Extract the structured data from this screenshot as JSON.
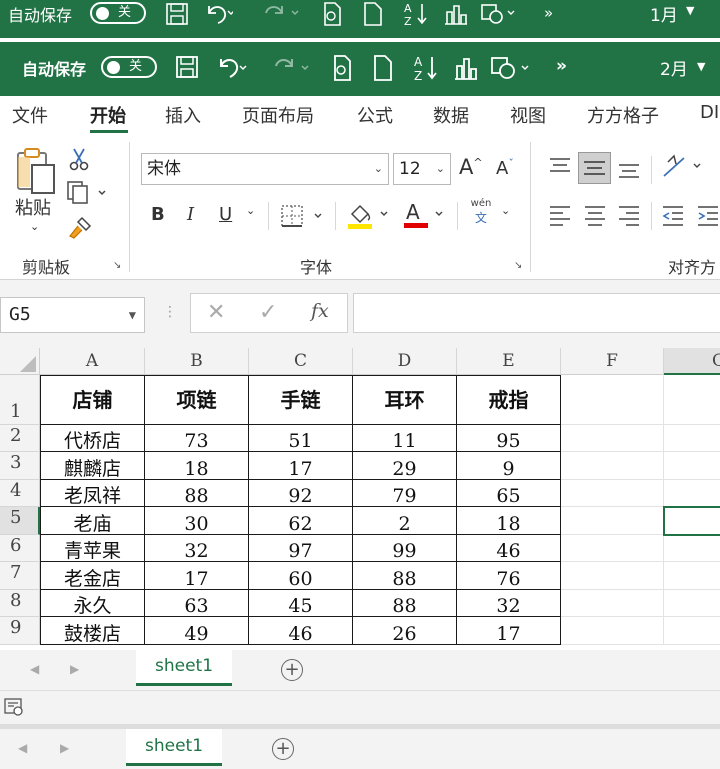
{
  "back_window": {
    "autosave_label": "自动保存",
    "toggle_state": "关",
    "month": "1月"
  },
  "window": {
    "autosave_label": "自动保存",
    "toggle_state": "关",
    "month": "2月"
  },
  "menu": {
    "items": [
      "文件",
      "开始",
      "插入",
      "页面布局",
      "公式",
      "数据",
      "视图",
      "方方格子",
      "DI"
    ],
    "active": "开始"
  },
  "ribbon": {
    "clipboard": {
      "paste_label": "粘贴",
      "group_label": "剪贴板"
    },
    "font": {
      "font_name": "宋体",
      "font_size": "12",
      "bold": "B",
      "italic": "I",
      "underline": "U",
      "grow": "A",
      "shrink": "A",
      "font_color_letter": "A",
      "phonetic_top": "wén",
      "phonetic_bottom": "文",
      "group_label": "字体"
    },
    "alignment": {
      "group_label": "对齐方"
    }
  },
  "formula_bar": {
    "name_box": "G5",
    "fx": "fx",
    "formula": ""
  },
  "sheet": {
    "columns": [
      "A",
      "B",
      "C",
      "D",
      "E",
      "F",
      "G"
    ],
    "selected_column": "G",
    "selected_row": 5,
    "row_numbers": [
      "1",
      "2",
      "3",
      "4",
      "5",
      "6",
      "7",
      "8",
      "9"
    ],
    "headers": [
      "店铺",
      "项链",
      "手链",
      "耳环",
      "戒指"
    ],
    "rows": [
      [
        "代桥店",
        "73",
        "51",
        "11",
        "95"
      ],
      [
        "麒麟店",
        "18",
        "17",
        "29",
        "9"
      ],
      [
        "老凤祥",
        "88",
        "92",
        "79",
        "65"
      ],
      [
        "老庙",
        "30",
        "62",
        "2",
        "18"
      ],
      [
        "青苹果",
        "32",
        "97",
        "99",
        "46"
      ],
      [
        "老金店",
        "17",
        "60",
        "88",
        "76"
      ],
      [
        "永久",
        "63",
        "45",
        "88",
        "32"
      ],
      [
        "鼓楼店",
        "49",
        "46",
        "26",
        "17"
      ]
    ]
  },
  "tabs": {
    "sheet_name": "sheet1",
    "back_sheet_name": "sheet1"
  },
  "colors": {
    "accent": "#217346",
    "font_highlight": "#ffe600",
    "font_color": "#e00000"
  }
}
